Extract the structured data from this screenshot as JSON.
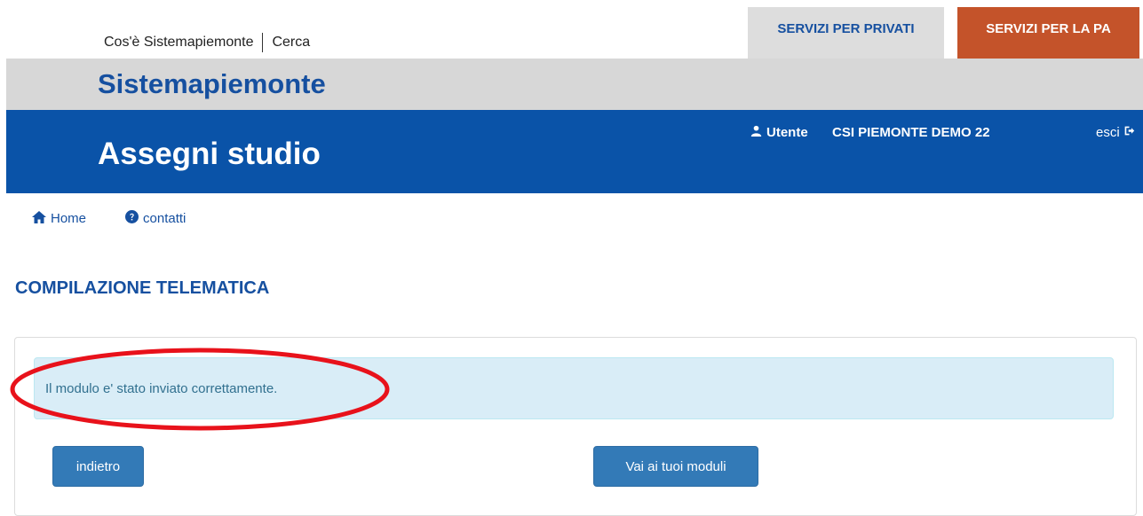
{
  "topbar": {
    "links": {
      "about": "Cos'è Sistemapiemonte",
      "search": "Cerca"
    },
    "tabs": {
      "privati": "SERVIZI PER PRIVATI",
      "pa": "SERVIZI PER LA PA"
    }
  },
  "brand": {
    "name": "Sistemapiemonte"
  },
  "app": {
    "title": "Assegni studio",
    "user_label": "Utente",
    "user_name": "CSI PIEMONTE DEMO 22",
    "logout_label": "esci"
  },
  "nav": {
    "home": "Home",
    "contacts": "contatti"
  },
  "main": {
    "heading": "COMPILAZIONE TELEMATICA",
    "alert_message": "Il modulo e' stato inviato correttamente.",
    "back_button": "indietro",
    "modules_button": "Vai ai tuoi moduli"
  },
  "colors": {
    "primary_blue": "#0a53a8",
    "pa_tab": "#c4532a",
    "button_blue": "#337ab7",
    "alert_bg": "#d9edf7",
    "annotation_red": "#e8121b"
  },
  "icons": [
    "user-icon",
    "logout-icon",
    "home-icon",
    "question-circle-icon"
  ]
}
